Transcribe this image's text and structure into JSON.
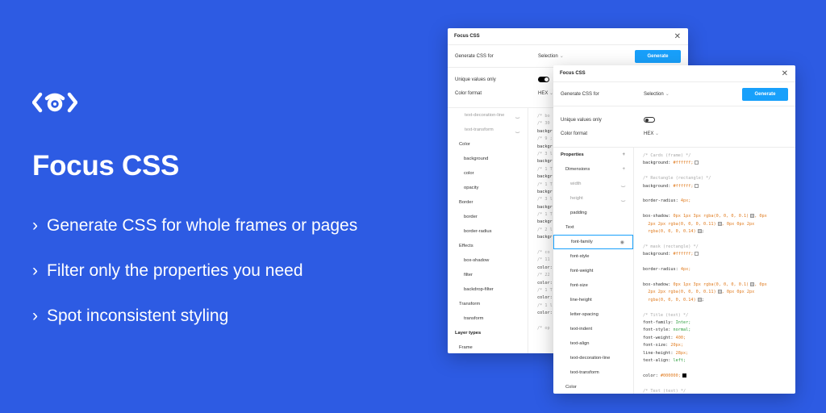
{
  "hero": {
    "logo_icon": "eye-code-icon",
    "title": "Focus CSS",
    "features": [
      "Generate CSS for whole frames or pages",
      "Filter only the properties you need",
      "Spot inconsistent styling"
    ]
  },
  "win1": {
    "title": "Focus CSS",
    "generate_label": "Generate CSS for",
    "selection_value": "Selection",
    "generate_button": "Generate",
    "unique_label": "Unique values only",
    "color_format_label": "Color format",
    "color_format_value": "HEX",
    "props": [
      "text-decoration-line",
      "text-transform",
      "Color",
      "background",
      "color",
      "opacity",
      "Border",
      "border",
      "border-radius",
      "Effects",
      "box-shadow",
      "filter",
      "backdrop-filter",
      "Transform",
      "transform",
      "Layer types",
      "Frame"
    ],
    "code_lines": [
      "/* bo",
      "/* 30",
      "backgr",
      "/* 9 ;",
      "backgr",
      "/* 3 l",
      "backgr",
      "/* 1 T",
      "backgr",
      "/* 1 T",
      "backgr",
      "/* 3 l",
      "backgr",
      "/* 1 T",
      "backgr",
      "/* 2 l",
      "backgr",
      "",
      "/* co",
      "/* 11",
      "color:",
      "/* 22",
      "color:",
      "/* 1 T",
      "color:",
      "/* 1 l",
      "color:",
      "",
      "/* op"
    ]
  },
  "win2": {
    "title": "Focus CSS",
    "generate_label": "Generate CSS for",
    "selection_value": "Selection",
    "generate_button": "Generate",
    "unique_label": "Unique values only",
    "color_format_label": "Color format",
    "color_format_value": "HEX",
    "props": [
      "Properties",
      "Dimensions",
      "width",
      "height",
      "padding",
      "Text",
      "font-family",
      "font-style",
      "font-weight",
      "font-size",
      "line-height",
      "letter-spacing",
      "text-indent",
      "text-align",
      "text-decoration-line",
      "text-transform",
      "Color"
    ],
    "code": {
      "c1": "/* Cards (frame) */",
      "c2": "/* Rectangle (rectangle) */",
      "c3": "/* mask (rectangle) */",
      "c4": "/* Title (text) */",
      "bg_prop": "background:",
      "bg_val": "#ffffff;",
      "br_prop": "border-radius:",
      "br_val": "4px;",
      "bs_prop": "box-shadow:",
      "bs_l1a": "0px 1px 3px",
      "bs_l1b": "rgba(0, 0, 0, 0.1)",
      "bs_l1c": ", 0px",
      "bs_l2a": "2px 2px",
      "bs_l2b": "rgba(0, 0, 0, 0.11)",
      "bs_l2c": ", 0px 0px 2px",
      "bs_l3": "rgba(0, 0, 0, 0.14)",
      "bs2_l1b": "rgba(0, 0, 0, 0.1)",
      "bs2_l1c": ", 0px",
      "ff_prop": "font-family:",
      "ff_val": "Inter;",
      "fs_prop": "font-style:",
      "fs_val": "normal;",
      "fw_prop": "font-weight:",
      "fw_val": "400;",
      "fz_prop": "font-size:",
      "fz_val": "20px;",
      "lh_prop": "line-height:",
      "lh_val": "28px;",
      "ta_prop": "text-align:",
      "ta_val": "left;",
      "col_prop": "color:",
      "col_val": "#000000;",
      "last": "/* Text (text) */"
    }
  }
}
